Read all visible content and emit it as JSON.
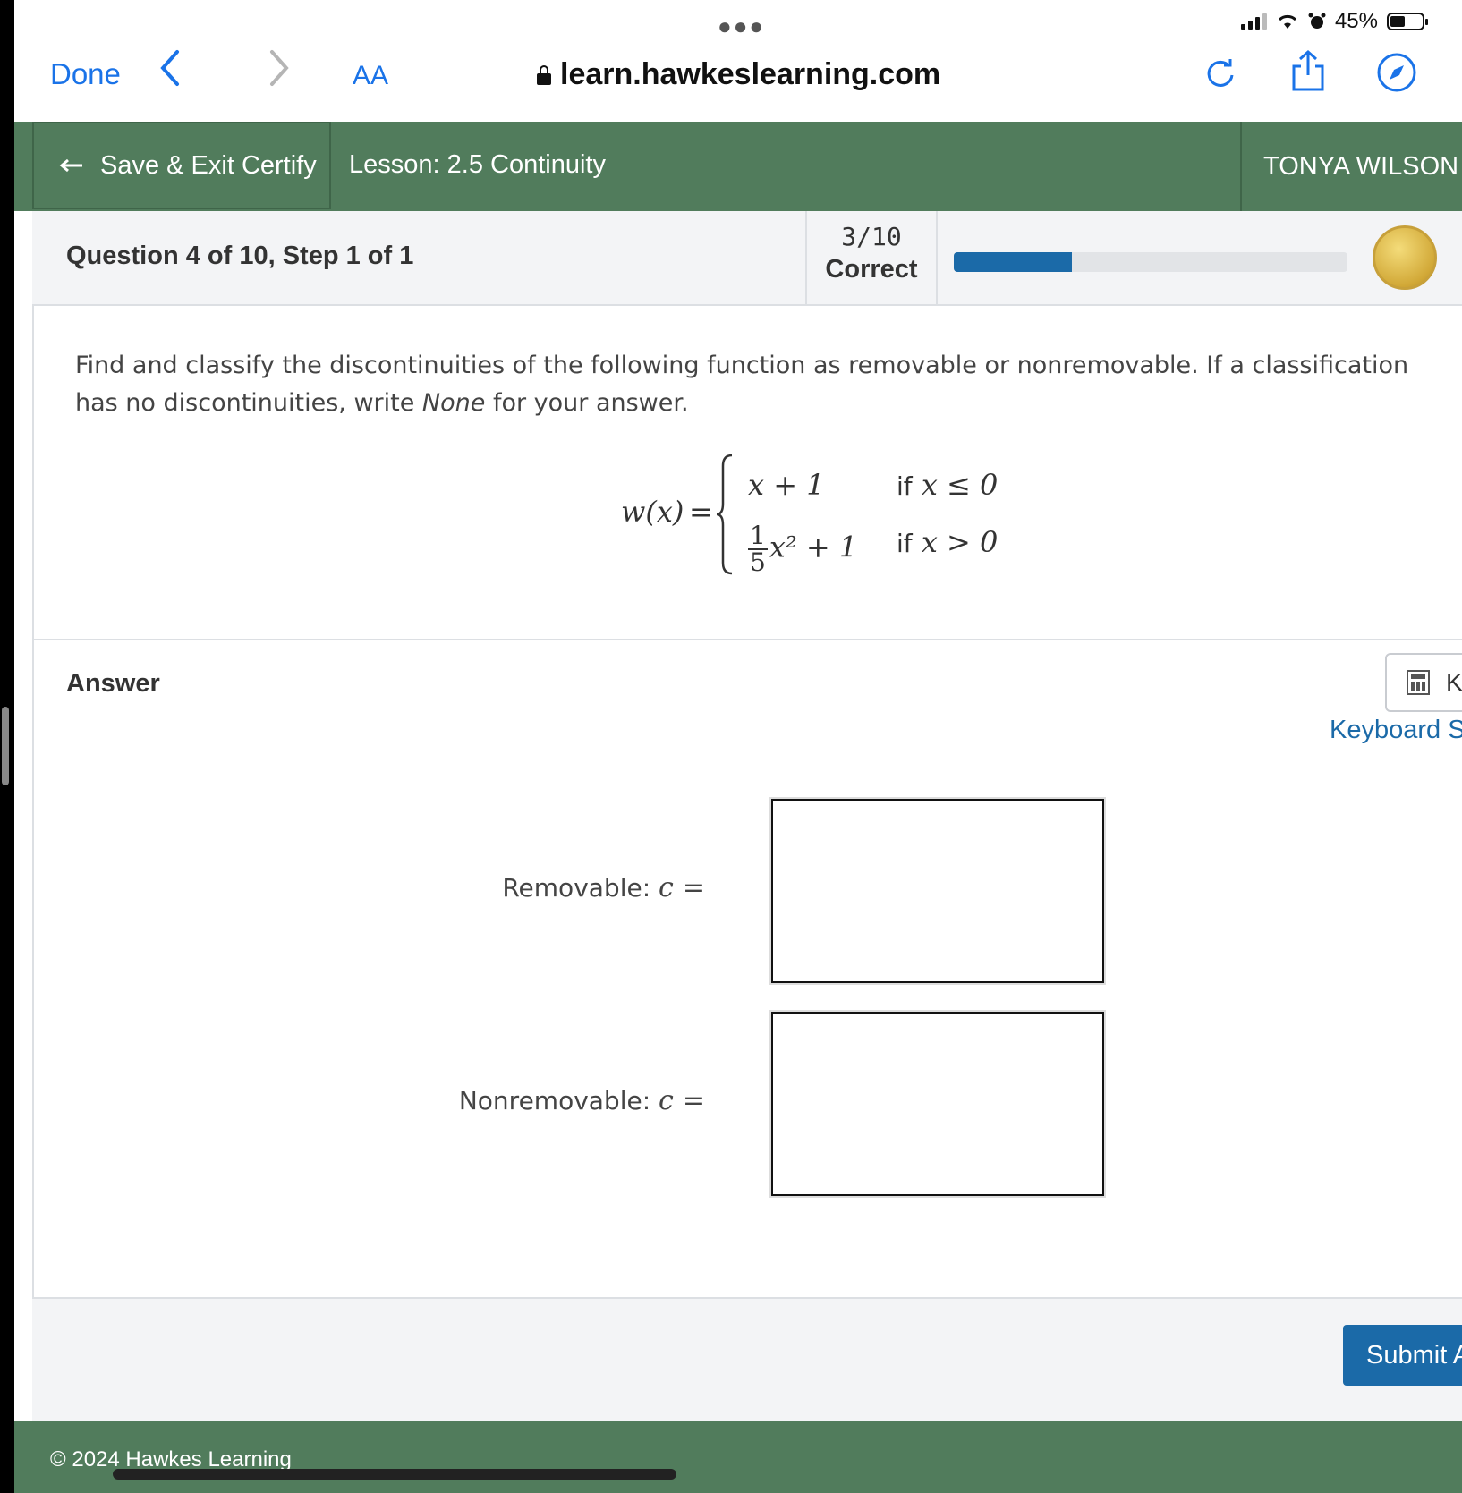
{
  "browser": {
    "done_label": "Done",
    "text_size_label": "AA",
    "url": "learn.hawkeslearning.com",
    "battery": "45%"
  },
  "header": {
    "save_exit_label": "Save & Exit Certify",
    "lesson": "Lesson: 2.5 Continuity",
    "user_name": "TONYA WILSON"
  },
  "question_bar": {
    "title": "Question 4 of 10, Step 1 of 1",
    "score": "3/10",
    "score_label": "Correct",
    "progress_fraction": 0.3
  },
  "question": {
    "text_before": "Find and classify the discontinuities of the following function as removable or nonremovable. If a classification has no discontinuities, write ",
    "text_italic": "None",
    "text_after": " for your answer.",
    "function_name": "w(x)",
    "piece1_expr": "x + 1",
    "piece1_condition": "x ≤ 0",
    "piece2_frac_num": "1",
    "piece2_frac_den": "5",
    "piece2_rest": "x² + 1",
    "piece2_condition": "x > 0",
    "if_word": "if"
  },
  "answer": {
    "heading": "Answer",
    "keypad_button_label": "K",
    "keyboard_shortcuts_link": "Keyboard S",
    "removable_label": "Removable:",
    "nonremovable_label": "Nonremovable:",
    "variable": "c",
    "equals": "=",
    "removable_value": "",
    "nonremovable_value": ""
  },
  "footer": {
    "submit_label": "Submit Ar",
    "copyright": "© 2024 Hawkes Learning"
  },
  "colors": {
    "header_green": "#517c5c",
    "accent_blue": "#1b6aa8",
    "link_blue": "#1a73e8"
  }
}
